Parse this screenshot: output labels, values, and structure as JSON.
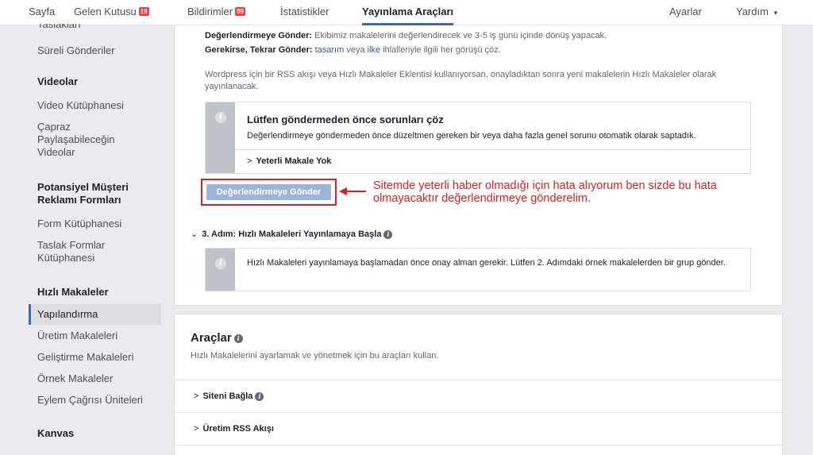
{
  "nav": {
    "sayfa": "Sayfa",
    "gelen_kutusu": "Gelen Kutusu",
    "gelen_badge": "19",
    "bildirimler": "Bildirimler",
    "bildirimler_badge": "99",
    "istatistikler": "İstatistikler",
    "yayinlama": "Yayınlama Araçları",
    "ayarlar": "Ayarlar",
    "yardim": "Yardım"
  },
  "sidebar": {
    "items": [
      "Taslakları",
      "Süreli Gönderiler",
      "Videolar",
      "Video Kütüphanesi",
      "Çapraz",
      "Paylaşabileceğin",
      "Videolar",
      "Potansiyel Müşteri",
      "Reklamı Formları",
      "Form Kütüphanesi",
      "Taslak Formlar",
      "Kütüphanesi",
      "Hızlı Makaleler",
      "Yapılandırma",
      "Üretim Makaleleri",
      "Geliştirme Makaleleri",
      "Örnek Makaleler",
      "Eylem Çağrısı Üniteleri",
      "Kanvas"
    ]
  },
  "review": {
    "line1_label": "Değerlendirmeye Gönder:",
    "line1_text": "Ekibimiz makalelerini değerlendirecek ve 3-5 iş günü içinde dönüş yapacak.",
    "line2_label": "Gerekirse, Tekrar Gönder:",
    "line2_link1": "tasarım",
    "line2_mid": "veya",
    "line2_link2": "ilke",
    "line2_text": "ihlalleriyle ilgili her görüşü çöz.",
    "rss_note": "Wordpress için bir RSS akışı veya Hızlı Makaleler Eklentisi kullanıyorsan, onayladıktan sonra yeni makalelerin Hızlı Makaleler olarak yayınlanacak.",
    "issues_title": "Lütfen göndermeden önce sorunları çöz",
    "issues_text": "Değerlendirmeye göndermeden önce düzeltmen gereken bir veya daha fazla genel sorunu otomatik olarak saptadık.",
    "issues_item": "Yeterli Makale Yok",
    "submit_button": "Değerlendirmeye Gönder",
    "annotation_line1": "Sitemde yeterli haber olmadığı için hata alıyorum ben sizde bu hata",
    "annotation_line2": "olmayacaktır değerlendirmeye gönderelim.",
    "step3_title": "3. Adım: Hızlı Makaleleri Yayınlamaya Başla",
    "step3_text": "Hızlı Makaleleri yayınlamaya başlamadan önce onay alman gerekir. Lütfen 2. Adımdaki örnek makalelerden bir grup gönder."
  },
  "tools": {
    "title": "Araçlar",
    "subtitle": "Hızlı Makalelerini ayarlamak ve yönetmek için bu araçları kullan.",
    "rows": [
      "Siteni Bağla",
      "Üretim RSS Akışı"
    ]
  },
  "colors": {
    "accent": "#4267b2",
    "badge": "#fa3e3e",
    "annotation": "#e02020",
    "disabled_button": "#9cb4d8"
  },
  "icons": {
    "info": "info-icon",
    "help": "help-icon",
    "chevron_right": "chevron-right-icon",
    "chevron_down": "chevron-down-icon",
    "arrow": "red-arrow-icon"
  }
}
